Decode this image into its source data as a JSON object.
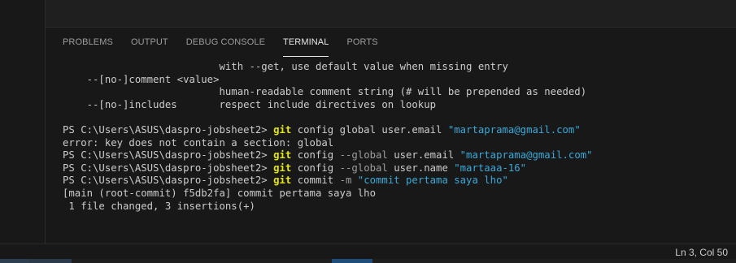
{
  "panel": {
    "tabs": [
      {
        "label": "PROBLEMS",
        "active": false
      },
      {
        "label": "OUTPUT",
        "active": false
      },
      {
        "label": "DEBUG CONSOLE",
        "active": false
      },
      {
        "label": "TERMINAL",
        "active": true
      },
      {
        "label": "PORTS",
        "active": false
      }
    ]
  },
  "terminal": {
    "lines": [
      [
        {
          "t": "                          with --get, use default value when missing entry"
        }
      ],
      [
        {
          "t": "    --[no-]comment <value>"
        }
      ],
      [
        {
          "t": "                          human-readable comment string (# will be prepended as needed)"
        }
      ],
      [
        {
          "t": "    --[no-]includes       respect include directives on lookup"
        }
      ],
      [
        {
          "t": ""
        }
      ],
      [
        {
          "t": "PS C:\\Users\\ASUS\\daspro-jobsheet2> "
        },
        {
          "t": "git",
          "c": "git"
        },
        {
          "t": " config global user.email "
        },
        {
          "t": "\"martaprama@gmail.com\"",
          "c": "str"
        }
      ],
      [
        {
          "t": "error: key does not contain a section: global"
        }
      ],
      [
        {
          "t": "PS C:\\Users\\ASUS\\daspro-jobsheet2> "
        },
        {
          "t": "git",
          "c": "git"
        },
        {
          "t": " config "
        },
        {
          "t": "--global",
          "c": "flag"
        },
        {
          "t": " user.email "
        },
        {
          "t": "\"martaprama@gmail.com\"",
          "c": "str"
        }
      ],
      [
        {
          "t": "PS C:\\Users\\ASUS\\daspro-jobsheet2> "
        },
        {
          "t": "git",
          "c": "git"
        },
        {
          "t": " config "
        },
        {
          "t": "--global",
          "c": "flag"
        },
        {
          "t": " user.name "
        },
        {
          "t": "\"martaaa-16\"",
          "c": "str"
        }
      ],
      [
        {
          "t": "PS C:\\Users\\ASUS\\daspro-jobsheet2> "
        },
        {
          "t": "git",
          "c": "git"
        },
        {
          "t": " commit "
        },
        {
          "t": "-m",
          "c": "flag"
        },
        {
          "t": " "
        },
        {
          "t": "\"commit pertama saya lho\"",
          "c": "str"
        }
      ],
      [
        {
          "t": "[main (root-commit) f5db2fa] commit pertama saya lho"
        }
      ],
      [
        {
          "t": " 1 file changed, 3 insertions(+)"
        }
      ]
    ]
  },
  "status": {
    "cursor": "Ln 3, Col 50"
  },
  "colors": {
    "git_command": "#e5e510",
    "string": "#3ba9d9",
    "flag": "#9d9d9d",
    "text": "#cccccc"
  }
}
